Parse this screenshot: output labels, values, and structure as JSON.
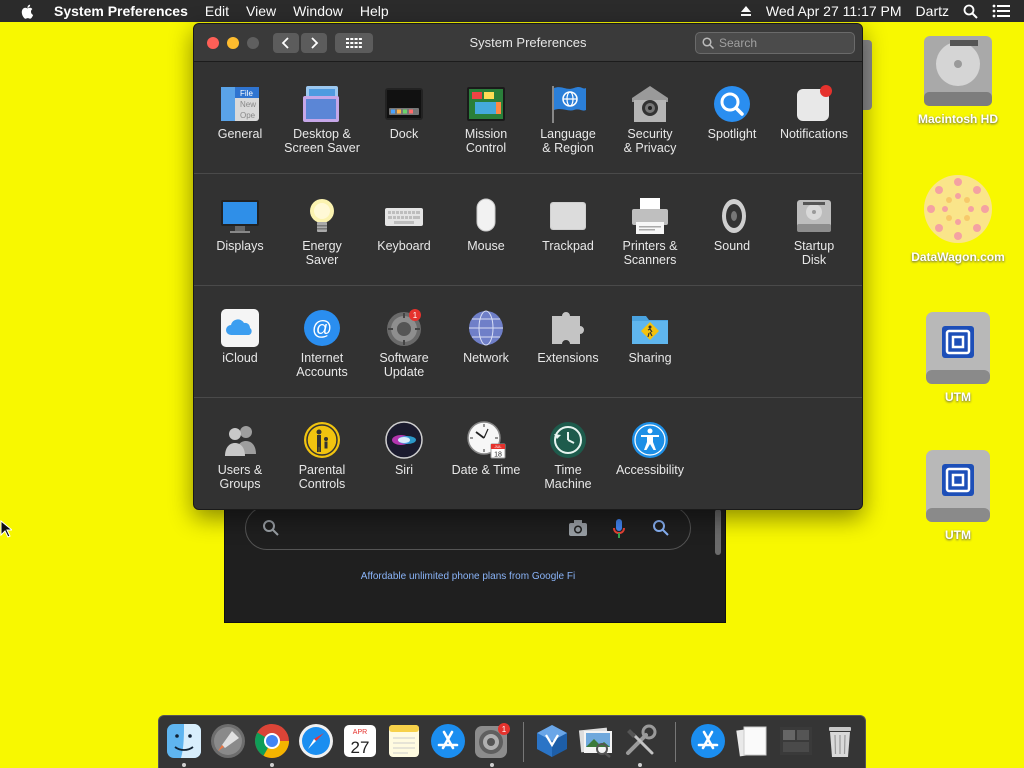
{
  "menubar": {
    "app_name": "System Preferences",
    "items": [
      "Edit",
      "View",
      "Window",
      "Help"
    ],
    "datetime": "Wed Apr 27  11:17 PM",
    "user": "Dartz"
  },
  "window": {
    "title": "System Preferences",
    "search_placeholder": "Search"
  },
  "prefs": {
    "row1": [
      {
        "label": "General",
        "icon": "general-icon"
      },
      {
        "label": "Desktop &\nScreen Saver",
        "icon": "desktop-screensaver-icon"
      },
      {
        "label": "Dock",
        "icon": "dock-icon"
      },
      {
        "label": "Mission\nControl",
        "icon": "mission-control-icon"
      },
      {
        "label": "Language\n& Region",
        "icon": "language-region-icon"
      },
      {
        "label": "Security\n& Privacy",
        "icon": "security-privacy-icon"
      },
      {
        "label": "Spotlight",
        "icon": "spotlight-icon"
      },
      {
        "label": "Notifications",
        "icon": "notifications-icon"
      }
    ],
    "row2": [
      {
        "label": "Displays",
        "icon": "displays-icon"
      },
      {
        "label": "Energy\nSaver",
        "icon": "energy-saver-icon"
      },
      {
        "label": "Keyboard",
        "icon": "keyboard-icon"
      },
      {
        "label": "Mouse",
        "icon": "mouse-icon"
      },
      {
        "label": "Trackpad",
        "icon": "trackpad-icon"
      },
      {
        "label": "Printers &\nScanners",
        "icon": "printers-scanners-icon"
      },
      {
        "label": "Sound",
        "icon": "sound-icon"
      },
      {
        "label": "Startup\nDisk",
        "icon": "startup-disk-icon"
      }
    ],
    "row3": [
      {
        "label": "iCloud",
        "icon": "icloud-icon"
      },
      {
        "label": "Internet\nAccounts",
        "icon": "internet-accounts-icon"
      },
      {
        "label": "Software\nUpdate",
        "icon": "software-update-icon",
        "badge": "1"
      },
      {
        "label": "Network",
        "icon": "network-icon"
      },
      {
        "label": "Extensions",
        "icon": "extensions-icon"
      },
      {
        "label": "Sharing",
        "icon": "sharing-icon"
      }
    ],
    "row4": [
      {
        "label": "Users &\nGroups",
        "icon": "users-groups-icon"
      },
      {
        "label": "Parental\nControls",
        "icon": "parental-controls-icon"
      },
      {
        "label": "Siri",
        "icon": "siri-icon"
      },
      {
        "label": "Date & Time",
        "icon": "date-time-icon"
      },
      {
        "label": "Time\nMachine",
        "icon": "time-machine-icon"
      },
      {
        "label": "Accessibility",
        "icon": "accessibility-icon"
      }
    ]
  },
  "general_icon_text": [
    "File",
    "New",
    "Ope"
  ],
  "date_icon_text": {
    "month": "JUL",
    "day": "18"
  },
  "desktop": [
    {
      "label": "Macintosh HD",
      "icon": "hard-drive-icon"
    },
    {
      "label": "DataWagon.com",
      "icon": "datawagon-icon"
    },
    {
      "label": "UTM",
      "icon": "utm-drive-icon"
    },
    {
      "label": "UTM",
      "icon": "utm-drive-icon"
    }
  ],
  "browser": {
    "promo": "Affordable unlimited phone plans from Google Fi"
  },
  "dock": {
    "calendar": {
      "month": "APR",
      "day": "27"
    },
    "prefs_badge": "1",
    "items": [
      "finder-icon",
      "launchpad-icon",
      "chrome-icon",
      "safari-icon",
      "calendar-icon",
      "notes-icon",
      "app-store-icon",
      "system-preferences-icon",
      "virtualbox-icon",
      "preview-icon",
      "utilities-icon",
      "app-store-folder-icon",
      "documents-icon",
      "screenshot-icon",
      "trash-icon"
    ]
  },
  "colors": {
    "desktop": "#f8f800",
    "window_bg": "#323232",
    "close": "#fe5f57",
    "minimize": "#febc2e",
    "badge": "#e5322d",
    "link": "#8ab4f8"
  }
}
